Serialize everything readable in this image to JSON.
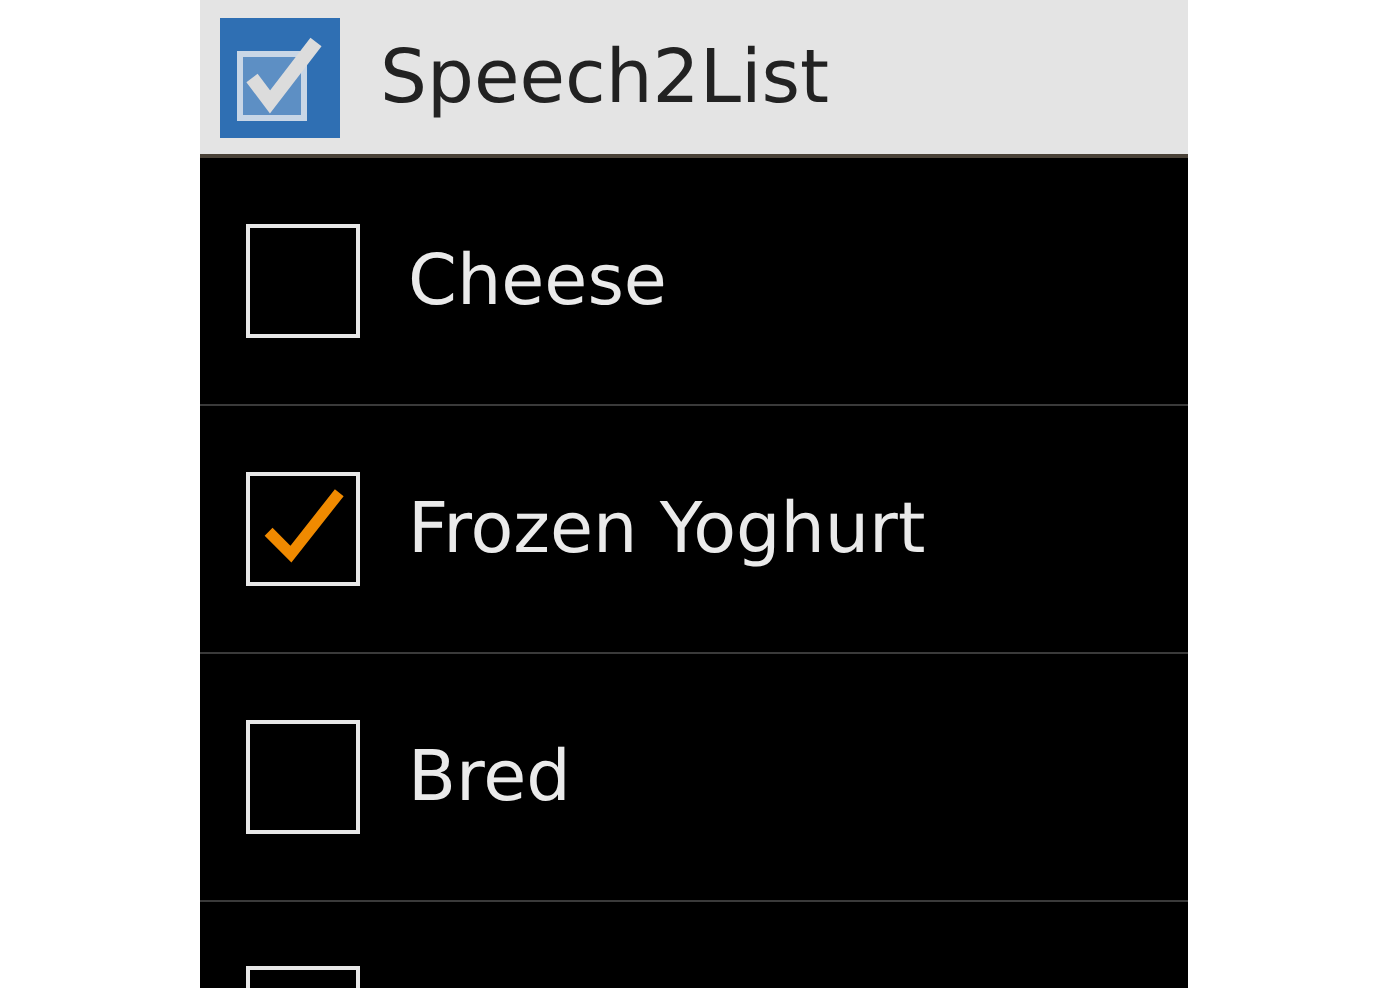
{
  "app_bar": {
    "title": "Speech2List"
  },
  "items": [
    {
      "label": "Cheese",
      "checked": false
    },
    {
      "label": "Frozen Yoghurt",
      "checked": true
    },
    {
      "label": "Bred",
      "checked": false
    },
    {
      "kind": "partial",
      "checked": false
    }
  ]
}
